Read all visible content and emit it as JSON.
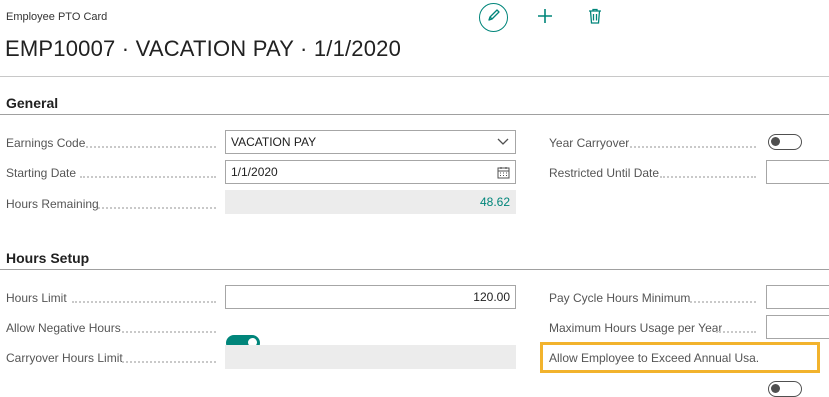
{
  "header": {
    "card_type": "Employee PTO Card",
    "title": "EMP10007 · VACATION PAY · 1/1/2020"
  },
  "actions": {
    "edit_icon": "pencil-icon",
    "new_icon": "plus-icon",
    "delete_icon": "trash-icon"
  },
  "general": {
    "section_title": "General",
    "earnings_code": {
      "label": "Earnings Code",
      "value": "VACATION PAY"
    },
    "starting_date": {
      "label": "Starting Date",
      "value": "1/1/2020"
    },
    "hours_remaining": {
      "label": "Hours Remaining",
      "value": "48.62"
    },
    "year_carryover": {
      "label": "Year Carryover",
      "state": "off"
    },
    "restricted_until_date": {
      "label": "Restricted Until Date",
      "value": ""
    }
  },
  "hours_setup": {
    "section_title": "Hours Setup",
    "hours_limit": {
      "label": "Hours Limit",
      "value": "120.00"
    },
    "allow_negative_hours": {
      "label": "Allow Negative Hours",
      "state": "on"
    },
    "carryover_hours_limit": {
      "label": "Carryover Hours Limit",
      "value": ""
    },
    "pay_cycle_hours_minimum": {
      "label": "Pay Cycle Hours Minimum",
      "value": ""
    },
    "maximum_hours_usage_per_year": {
      "label": "Maximum Hours Usage per Year",
      "value": ""
    },
    "allow_exceed_annual_usage": {
      "label": "Allow Employee to Exceed Annual Usa...",
      "state": "off"
    }
  },
  "colors": {
    "accent": "#00857a",
    "highlight": "#f2b32d"
  }
}
